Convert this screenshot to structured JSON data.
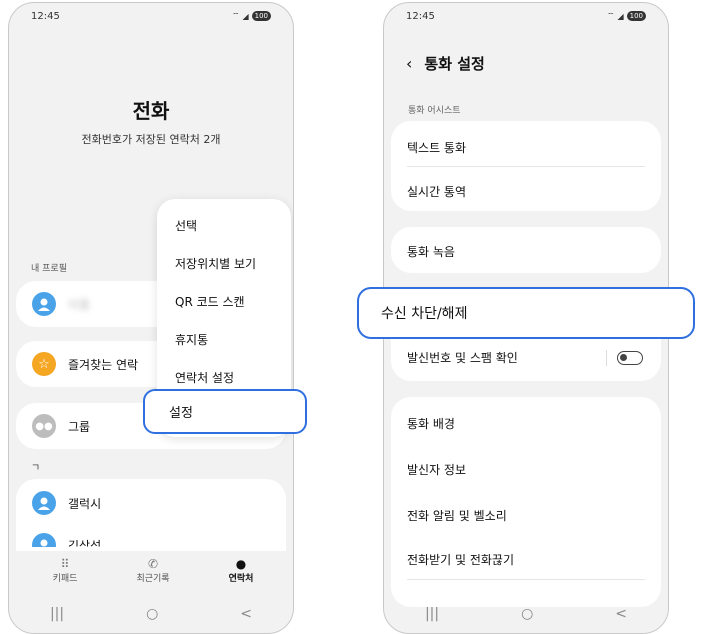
{
  "status": {
    "time": "12:45",
    "battery": "100"
  },
  "left": {
    "title": "전화",
    "subtitle": "전화번호가 저장된 연락처 2개",
    "my_profile_label": "내 프로필",
    "profile_name": "이름",
    "favorites_label": "즐겨찾는 연락",
    "group_label": "그룹",
    "index_letter": "ㄱ",
    "contact1": "갤럭시",
    "contact2": "김삼성",
    "menu": [
      "선택",
      "저장위치별 보기",
      "QR 코드 스캔",
      "휴지통",
      "연락처 설정",
      "설정"
    ],
    "tabs": {
      "keypad": "키패드",
      "recents": "최근기록",
      "contacts": "연락처"
    }
  },
  "right": {
    "title": "통화 설정",
    "section_label": "통화 어시스트",
    "items_group1": [
      "텍스트 통화",
      "실시간 통역"
    ],
    "item_record": "통화 녹음",
    "item_block": "수신 차단/해제",
    "item_spam": "발신번호 및 스팸 확인",
    "items_group3": [
      "통화 배경",
      "발신자 정보",
      "전화 알림 및 벨소리",
      "전화받기 및 전화끊기"
    ]
  },
  "nav": {
    "recent_apps": "|||",
    "home": "○",
    "back": "<"
  },
  "colors": {
    "accent": "#2f6fe0",
    "favorite": "#f5a623",
    "avatar": "#4aa3e8"
  }
}
